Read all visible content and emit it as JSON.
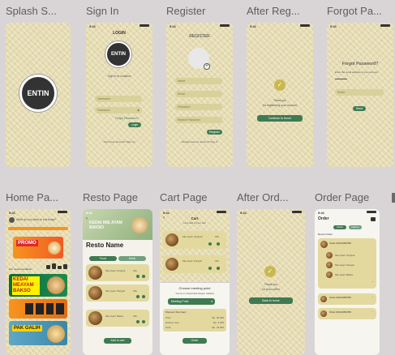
{
  "frames": [
    {
      "title": "Splash S...",
      "screen": "splash"
    },
    {
      "title": "Sign In",
      "screen": "sign-in"
    },
    {
      "title": "Register",
      "screen": "register"
    },
    {
      "title": "After Reg...",
      "screen": "after-register"
    },
    {
      "title": "Forgot Pa...",
      "screen": "forgot-password"
    },
    {
      "title": "Home Pa...",
      "screen": "home"
    },
    {
      "title": "Resto Page",
      "screen": "resto"
    },
    {
      "title": "Cart Page",
      "screen": "cart"
    },
    {
      "title": "After Ord...",
      "screen": "after-order"
    },
    {
      "title": "Order Page",
      "screen": "order"
    }
  ],
  "logo_text": "ENTIN",
  "status_time": "9:41",
  "sign_in": {
    "heading": "LOGIN",
    "subtitle": "Sign in to continue",
    "username_placeholder": "Username",
    "password_placeholder": "Password",
    "forgot_link": "Forgot Password?",
    "login_button": "Login",
    "footer": "Don't have account? Sign Up"
  },
  "register": {
    "heading": "REGISTER",
    "fields": [
      "Name",
      "Email",
      "Password",
      "Repeat Password"
    ],
    "button": "Register",
    "footer": "Already have an account? Sign In"
  },
  "after_register": {
    "line1": "Thank you",
    "line2": "for registering your account",
    "button": "Continue to Home"
  },
  "forgot": {
    "heading": "Forgot Password?",
    "desc": "Enter the email address of your account",
    "email_placeholder": "Email",
    "button": "Send"
  },
  "home": {
    "greeting": "What do you want to eat today?",
    "promo_label": "PROMO",
    "section": "Our recommendation",
    "banner1": "KEDAI MEAYAM BAKSO",
    "banner3": "PAK GALIH"
  },
  "resto": {
    "hero_text": "KEDAI MIE AYAM BAKSO",
    "name": "Resto Name",
    "tabs": [
      "Food",
      "Drink"
    ],
    "items": [
      "Mie Ayam Original",
      "Mie Ayam Pangsit",
      "Mie Ayam Bakso"
    ],
    "price": "15k",
    "button": "Add to cart"
  },
  "cart": {
    "heading": "Cart",
    "subtitle": "Let's add to your cart",
    "items": [
      "Mie Ayam Original",
      "Mie Ayam Pangsit"
    ],
    "price": "15k",
    "meeting_title": "Choose meeting point",
    "meeting_sub": "You're in Universitas Negeri Jakarta",
    "meeting_select": "Meeting Point",
    "summary_title": "Payment Summary",
    "summary_rows": [
      "Price",
      "Delivery Fee",
      "Total"
    ],
    "summary_values": [
      "Rp. 30.000",
      "Rp. 3.000",
      "Rp. 33.000"
    ],
    "button": "Order"
  },
  "after_order": {
    "line1": "Thank you",
    "line2": "for your order!",
    "button": "Back to home"
  },
  "order": {
    "heading": "Order",
    "tabs": [
      "Active",
      "History"
    ],
    "recent": "Recent Order",
    "order_id": "Order #0123456789",
    "items": [
      "Mie Ayam Original",
      "Mie Ayam Pangsit",
      "Mie Ayam Bakso"
    ]
  },
  "colors": {
    "background": "#d9d5d6",
    "pattern": "#e6dcb3",
    "accent_green": "#3f7a52",
    "field": "#d8d19a",
    "promo_orange": "#f7941d"
  }
}
